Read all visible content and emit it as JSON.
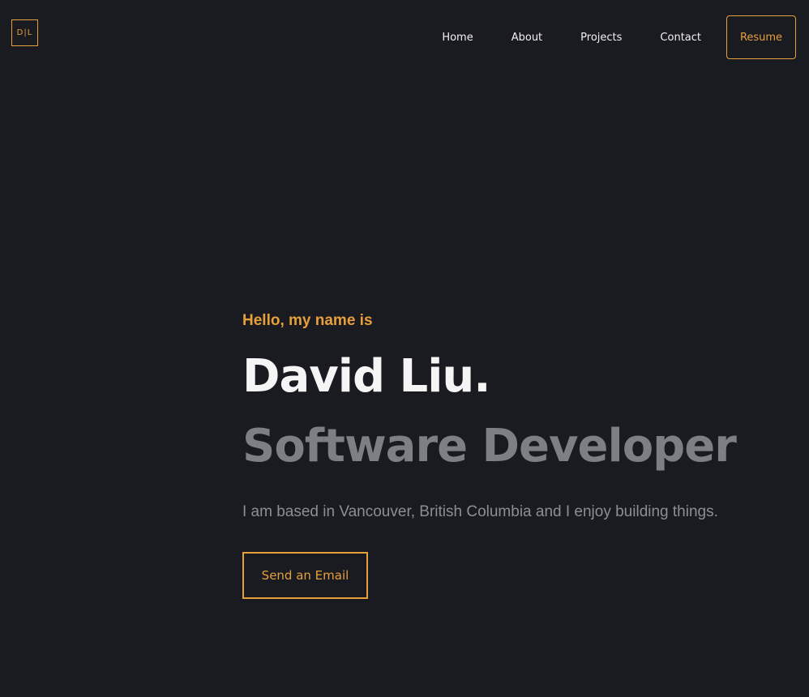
{
  "logo": {
    "text": "D|L"
  },
  "nav": {
    "links": [
      {
        "label": "Home"
      },
      {
        "label": "About"
      },
      {
        "label": "Projects"
      },
      {
        "label": "Contact"
      }
    ],
    "resume_label": "Resume"
  },
  "hero": {
    "greeting": "Hello, my name is",
    "name": "David Liu.",
    "role": "Software Developer",
    "tagline": "I am based in Vancouver, British Columbia and I enjoy building things.",
    "email_button_label": "Send an Email"
  },
  "colors": {
    "background": "#1a1a21",
    "accent": "#e5a03c",
    "heading": "#f5f5f5",
    "muted": "#7d7f85"
  }
}
